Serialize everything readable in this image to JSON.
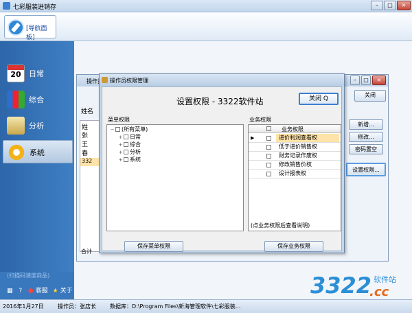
{
  "app": {
    "title": "七彩服装进销存",
    "nav_tab": "[导航面板]"
  },
  "sidebar": {
    "items": [
      {
        "label": "日常",
        "icon": "calendar-icon",
        "date": "20"
      },
      {
        "label": "综合",
        "icon": "binders-icon"
      },
      {
        "label": "分析",
        "icon": "chart-icon"
      },
      {
        "label": "系统",
        "icon": "gear-icon"
      }
    ],
    "hint": "(扫描码速度商品)",
    "tools": {
      "service": "客服",
      "about": "关于"
    }
  },
  "background_window": {
    "title": "操作员",
    "column": "姓名",
    "rows": [
      "姓",
      "张",
      "王",
      "春",
      "332"
    ],
    "footer": "合计",
    "buttons": {
      "close": "关闭",
      "add": "新增...",
      "edit": "修改...",
      "reset_pwd": "密码置空",
      "set_perm": "设置权限..."
    }
  },
  "dialog": {
    "title": "操作员权限管理",
    "heading": "设置权限 - 3322软件站",
    "close_label": "关闭 Q",
    "menu_group": "菜单权限",
    "business_group": "业务权限",
    "tree": {
      "root": "(所有菜单)",
      "children": [
        "日常",
        "综合",
        "分析",
        "系统"
      ]
    },
    "grid": {
      "header": "业务权限",
      "rows": [
        "进价利润查看权",
        "低于进价销售权",
        "财务记录作废权",
        "修改销售价权",
        "设计报表权"
      ],
      "selected_index": 0
    },
    "note": "(点业务权限后查看说明)",
    "save_menu": "保存菜单权限",
    "save_business": "保存业务权限"
  },
  "statusbar": {
    "date": "2016年1月27日",
    "operator": "操作员：张店长",
    "database": "数据库：D:\\Program Files\\新海管理软件\\七彩服装..."
  },
  "watermark": {
    "num": "3322",
    "brand": "软件站",
    "tld": ".cc"
  },
  "colors": {
    "sidebar": "#3f7fc4",
    "accent": "#3c7fcf",
    "selected_row": "#ffe3a8"
  }
}
